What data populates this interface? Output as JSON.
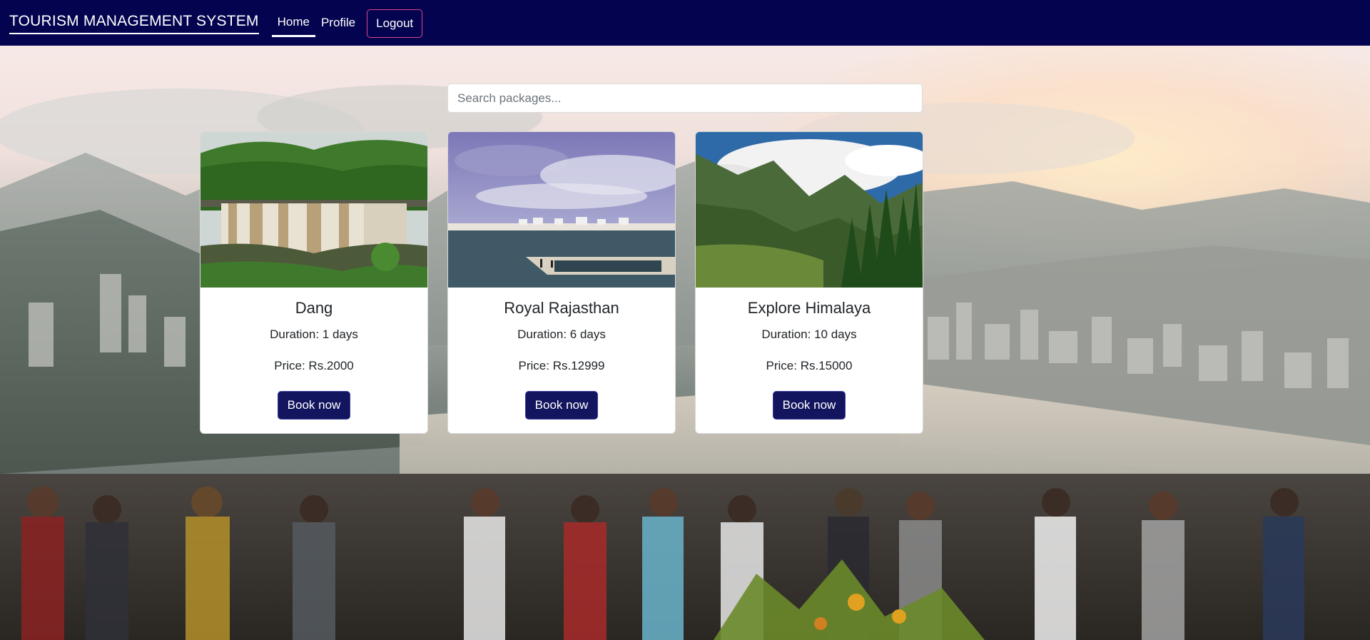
{
  "navbar": {
    "brand": "TOURISM MANAGEMENT SYSTEM",
    "links": [
      {
        "label": "Home",
        "active": true
      },
      {
        "label": "Profile",
        "active": false
      }
    ],
    "logout_label": "Logout"
  },
  "search": {
    "placeholder": "Search packages...",
    "value": ""
  },
  "packages": [
    {
      "title": "Dang",
      "duration": "Duration: 1 days",
      "price": "Price: Rs.2000",
      "button": "Book now"
    },
    {
      "title": "Royal Rajasthan",
      "duration": "Duration: 6 days",
      "price": "Price: Rs.12999",
      "button": "Book now"
    },
    {
      "title": "Explore Himalaya",
      "duration": "Duration: 10 days",
      "price": "Price: Rs.15000",
      "button": "Book now"
    }
  ],
  "colors": {
    "navbar_bg": "#03034f",
    "button_bg": "#13155e",
    "logout_border": "#e0468a"
  }
}
